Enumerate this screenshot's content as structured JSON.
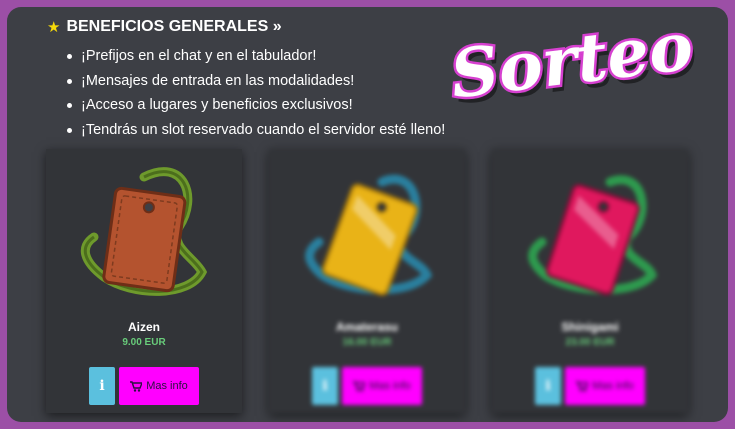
{
  "benefits": {
    "title": "BENEFICIOS GENERALES »",
    "items": [
      "¡Prefijos en el chat y en el tabulador!",
      "¡Mensajes de entrada en las modalidades!",
      "¡Acceso a lugares y beneficios exclusivos!",
      "¡Tendrás un slot reservado cuando el servidor esté lleno!"
    ]
  },
  "logo": {
    "text": "Sorteo"
  },
  "cards": [
    {
      "name": "Aizen",
      "price": "9.00 EUR",
      "info_label": "i",
      "more_label": "Mas info",
      "icon": "leather-tag-icon",
      "color": "#b4532f"
    },
    {
      "name": "Amaterasu",
      "price": "16.00 EUR",
      "info_label": "i",
      "more_label": "Mas info",
      "icon": "gold-tag-icon",
      "color": "#e9b317"
    },
    {
      "name": "Shinigami",
      "price": "23.00 EUR",
      "info_label": "i",
      "more_label": "Mas info",
      "icon": "crimson-tag-icon",
      "color": "#e0185e"
    }
  ],
  "colors": {
    "accent": "#ff00ff",
    "info": "#5bc0de",
    "price": "#68cc7a",
    "panel": "#3d3f45",
    "frame": "#9c4fa6"
  }
}
